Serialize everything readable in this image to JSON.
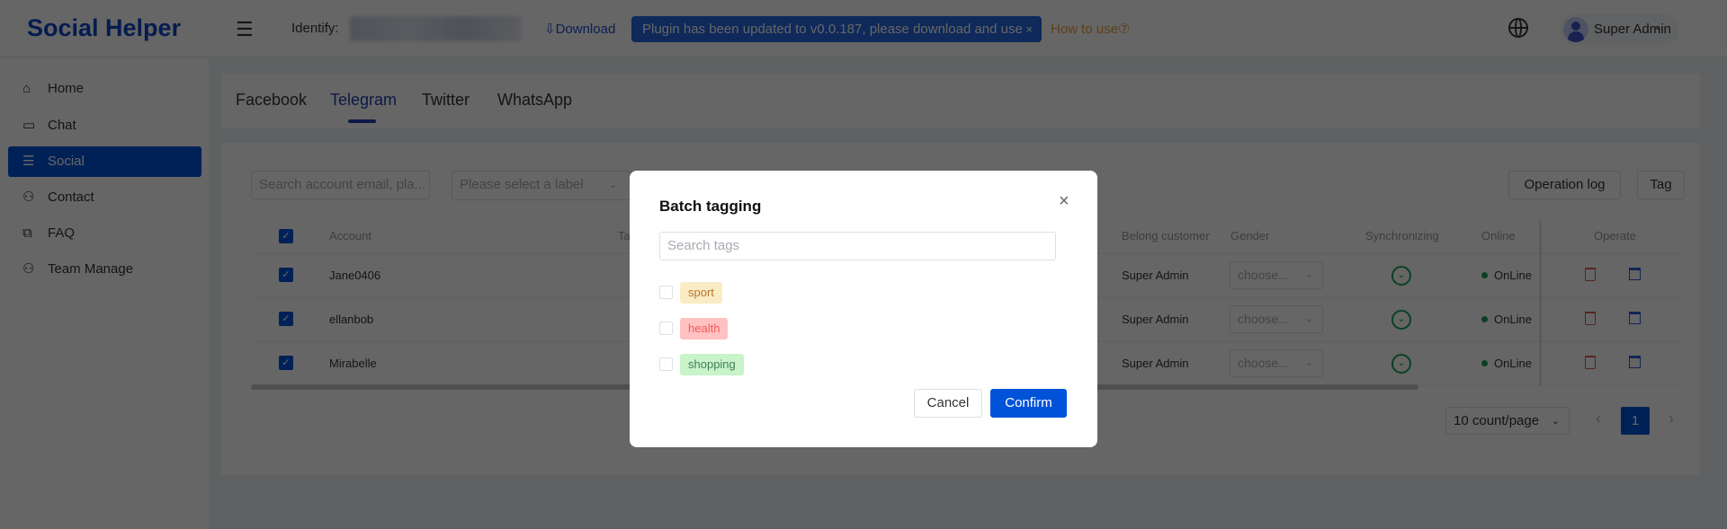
{
  "header": {
    "logo": "Social Helper",
    "identify_label": "Identify:",
    "download": "Download",
    "banner": "Plugin has been updated to v0.0.187, please download and use",
    "banner_close": "×",
    "how_to_use": "How to use⑦",
    "user": "Super Admin"
  },
  "sidebar": {
    "items": [
      {
        "label": "Home",
        "icon": "home-icon"
      },
      {
        "label": "Chat",
        "icon": "chat-icon"
      },
      {
        "label": "Social",
        "icon": "list-icon",
        "active": true
      },
      {
        "label": "Contact",
        "icon": "contact-icon"
      },
      {
        "label": "FAQ",
        "icon": "faq-icon"
      },
      {
        "label": "Team Manage",
        "icon": "team-icon"
      }
    ]
  },
  "tabs": [
    "Facebook",
    "Telegram",
    "Twitter",
    "WhatsApp"
  ],
  "active_tab": "Telegram",
  "toolbar": {
    "search_placeholder": "Search account email, pla...",
    "label_placeholder": "Please select a label",
    "operation_log": "Operation log",
    "tag": "Tag"
  },
  "table": {
    "columns": [
      "Account",
      "Ta",
      "Belong customer",
      "Gender",
      "Synchronizing",
      "Online",
      "Operate"
    ],
    "rows": [
      {
        "account": "Jane0406",
        "customer": "Super Admin",
        "gender": "choose...",
        "online": "OnLine",
        "checked": true
      },
      {
        "account": "ellanbob",
        "customer": "Super Admin",
        "gender": "choose...",
        "online": "OnLine",
        "checked": true
      },
      {
        "account": "Mirabelle",
        "customer": "Super Admin",
        "gender": "choose...",
        "online": "OnLine",
        "checked": true
      }
    ]
  },
  "pagination": {
    "page_size": "10 count/page",
    "current_page": "1",
    "prev": "‹",
    "next": "›"
  },
  "modal": {
    "title": "Batch tagging",
    "close": "×",
    "search_placeholder": "Search tags",
    "tags": [
      {
        "label": "sport",
        "bg": "#faecc5",
        "color": "#b9772b"
      },
      {
        "label": "health",
        "bg": "#ffc1c1",
        "color": "#f05c5c"
      },
      {
        "label": "shopping",
        "bg": "#c9f3c9",
        "color": "#3f7f56"
      }
    ],
    "cancel": "Cancel",
    "confirm": "Confirm"
  },
  "colors": {
    "primary": "#0052d9",
    "online": "#18a058",
    "danger": "#e05555",
    "warning": "#e6a23c"
  }
}
